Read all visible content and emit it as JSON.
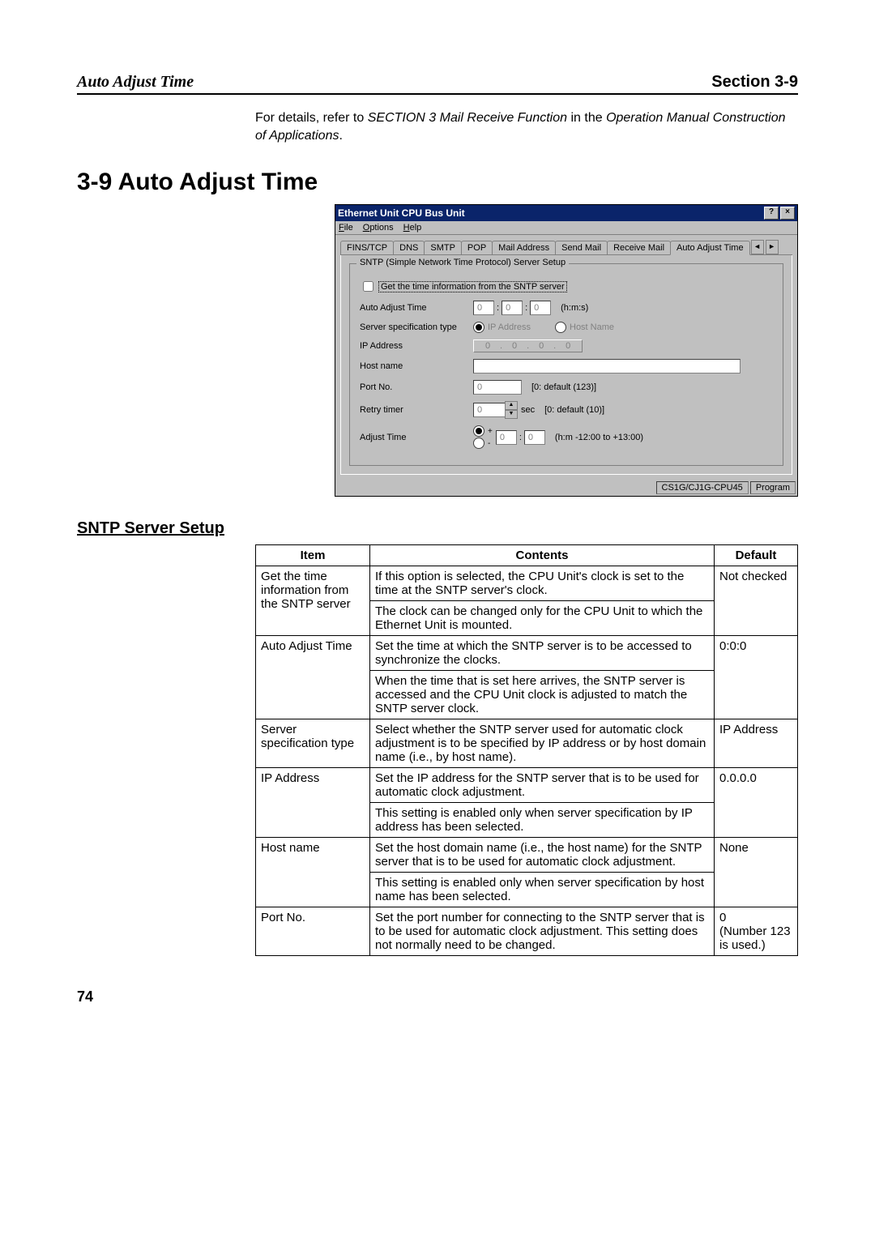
{
  "header": {
    "left": "Auto Adjust Time",
    "right": "Section 3-9"
  },
  "intro": {
    "pre": "For details, refer to ",
    "ital": "SECTION 3 Mail Receive Function",
    "mid": " in the ",
    "ital2": "Operation Manual Construction of Applications",
    "post": "."
  },
  "section_title": "3-9   Auto Adjust Time",
  "window": {
    "title": "Ethernet Unit CPU Bus Unit",
    "menus": [
      "File",
      "Options",
      "Help"
    ],
    "tabs": [
      "FINS/TCP",
      "DNS",
      "SMTP",
      "POP",
      "Mail Address",
      "Send Mail",
      "Receive Mail",
      "Auto Adjust Time"
    ],
    "group_legend": "SNTP (Simple Network Time Protocol) Server Setup",
    "chk_label": "Get the time information from the SNTP server",
    "labels": {
      "auto_adjust": "Auto Adjust Time",
      "hms": "(h:m:s)",
      "spec_type": "Server specification type",
      "ip_radio": "IP Address",
      "host_radio": "Host Name",
      "ip": "IP Address",
      "host": "Host name",
      "port": "Port No.",
      "port_hint": "[0: default (123)]",
      "retry": "Retry timer",
      "retry_unit": "sec",
      "retry_hint": "[0: default (10)]",
      "adjust": "Adjust Time",
      "adjust_hint": "(h:m  -12:00 to +13:00)",
      "plus": "+",
      "minus": "-"
    },
    "values": {
      "h": "0",
      "m": "0",
      "s": "0",
      "ip1": "0",
      "ip2": "0",
      "ip3": "0",
      "ip4": "0",
      "port": "0",
      "retry": "0",
      "ah": "0",
      "am": "0"
    },
    "status": {
      "cpu": "CS1G/CJ1G-CPU45",
      "mode": "Program"
    }
  },
  "subhead": "SNTP Server Setup",
  "table": {
    "headers": [
      "Item",
      "Contents",
      "Default"
    ],
    "rows": [
      {
        "item": "Get the time information from the SNTP server",
        "cells": [
          "If this option is selected, the CPU Unit's clock is set to the time at the SNTP server's clock.",
          "The clock can be changed only for the CPU Unit to which the Ethernet Unit is mounted."
        ],
        "def": "Not checked"
      },
      {
        "item": "Auto Adjust Time",
        "cells": [
          "Set the time at which the SNTP server is to be accessed to synchronize the clocks.",
          "When the time that is set here arrives, the SNTP server is accessed and the CPU Unit clock is adjusted to match the SNTP server clock."
        ],
        "def": "0:0:0"
      },
      {
        "item": "Server specification type",
        "cells": [
          "Select whether the SNTP server used for automatic clock adjustment is to be specified by IP address or by host domain name (i.e., by host name)."
        ],
        "def": "IP Address"
      },
      {
        "item": "IP Address",
        "cells": [
          "Set the IP address for the SNTP server that is to be used for automatic clock adjustment.",
          "This setting is enabled only when server specification by IP address has been selected."
        ],
        "def": "0.0.0.0"
      },
      {
        "item": "Host name",
        "cells": [
          "Set the host domain name (i.e., the host name) for the SNTP server that is to be used for automatic clock adjustment.",
          "This setting is enabled only when server specification by host name has been selected."
        ],
        "def": "None"
      },
      {
        "item": "Port No.",
        "cells": [
          "Set the port number for connecting to the SNTP server that is to be used for automatic clock adjustment. This setting does not normally need to be changed."
        ],
        "def": "0\n(Number 123 is used.)"
      }
    ]
  },
  "page_number": "74"
}
